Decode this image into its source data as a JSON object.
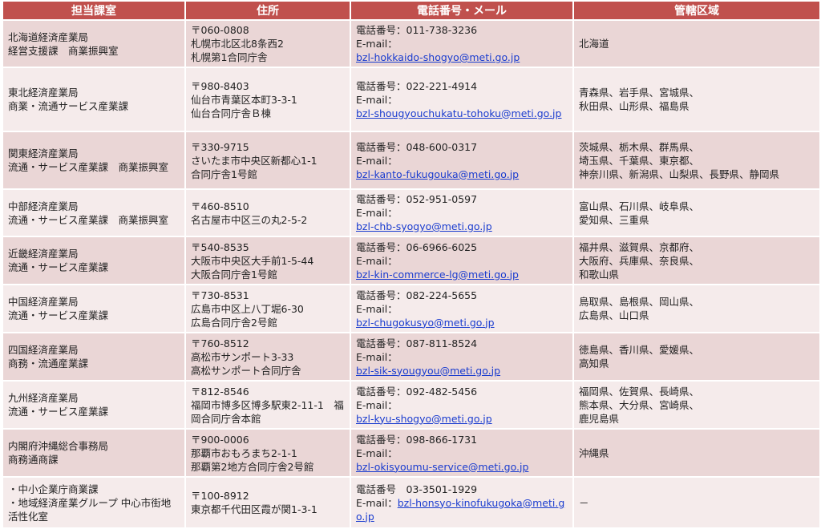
{
  "headers": [
    "担当課室",
    "住所",
    "電話番号・メール",
    "管轄区域"
  ],
  "rows": [
    {
      "dept": [
        "北海道経済産業局",
        "経営支援課　商業振興室"
      ],
      "addr": [
        "〒060-0808",
        "札幌市北区北8条西2",
        "札幌第1合同庁舎"
      ],
      "tel": "電話番号：011-738-3236",
      "mail_label": "E-mail：",
      "mail": "bzl-hokkaido-shogyo@meti.go.jp",
      "area": [
        "北海道"
      ]
    },
    {
      "dept": [
        "東北経済産業局",
        "商業・流通サービス産業課"
      ],
      "addr": [
        "〒980-8403",
        "仙台市青葉区本町3-3-1",
        "仙台合同庁舎Ｂ棟"
      ],
      "tel": "電話番号：022-221-4914",
      "mail_label": "E-mail：",
      "mail": "bzl-shougyouchukatu-tohoku@meti.go.jp",
      "area": [
        "青森県、岩手県、宮城県、",
        "秋田県、山形県、福島県"
      ]
    },
    {
      "dept": [
        "関東経済産業局",
        "流通・サービス産業課　商業振興室"
      ],
      "addr": [
        "〒330-9715",
        "さいたま市中央区新都心1-1",
        "合同庁舎1号館"
      ],
      "tel": "電話番号：048-600-0317",
      "mail_label": "E-mail：",
      "mail": "bzl-kanto-fukugouka@meti.go.jp",
      "area": [
        "茨城県、栃木県、群馬県、",
        "埼玉県、千葉県、東京都、",
        "神奈川県、新潟県、山梨県、長野県、静岡県"
      ]
    },
    {
      "dept": [
        "中部経済産業局",
        "流通・サービス産業課　商業振興室"
      ],
      "addr": [
        "〒460-8510",
        "名古屋市中区三の丸2-5-2"
      ],
      "tel": "電話番号：052-951-0597",
      "mail_label": "E-mail：",
      "mail": "bzl-chb-syogyo@meti.go.jp",
      "area": [
        "富山県、石川県、岐阜県、",
        "愛知県、三重県"
      ]
    },
    {
      "dept": [
        "近畿経済産業局",
        "流通・サービス産業課"
      ],
      "addr": [
        "〒540-8535",
        "大阪市中央区大手前1-5-44",
        "大阪合同庁舎1号館"
      ],
      "tel": "電話番号：06-6966-6025",
      "mail_label": "E-mail：",
      "mail": "bzl-kin-commerce-lg@meti.go.jp",
      "area": [
        "福井県、滋賀県、京都府、",
        "大阪府、兵庫県、奈良県、",
        "和歌山県"
      ]
    },
    {
      "dept": [
        "中国経済産業局",
        "流通・サービス産業課"
      ],
      "addr": [
        "〒730-8531",
        "広島市中区上八丁堀6-30",
        "広島合同庁舎2号館"
      ],
      "tel": "電話番号：082-224-5655",
      "mail_label": "E-mail：",
      "mail": "bzl-chugokusyo@meti.go.jp",
      "area": [
        "鳥取県、島根県、岡山県、",
        "広島県、山口県"
      ]
    },
    {
      "dept": [
        "四国経済産業局",
        "商務・流通産業課"
      ],
      "addr": [
        "〒760-8512",
        "高松市サンポート3-33",
        "高松サンポート合同庁舎"
      ],
      "tel": "電話番号：087-811-8524",
      "mail_label": "E-mail：",
      "mail": "bzl-sik-syougyou@meti.go.jp",
      "area": [
        "徳島県、香川県、愛媛県、",
        "高知県"
      ]
    },
    {
      "dept": [
        "九州経済産業局",
        "流通・サービス産業課"
      ],
      "addr": [
        "〒812-8546",
        "福岡市博多区博多駅東2-11-1　福岡合同庁舎本館"
      ],
      "tel": "電話番号：092-482-5456",
      "mail_label": "E-mail：",
      "mail": "bzl-kyu-shogyo@meti.go.jp",
      "area": [
        "福岡県、佐賀県、長崎県、",
        "熊本県、大分県、宮崎県、",
        "鹿児島県"
      ]
    },
    {
      "dept": [
        "内閣府沖縄総合事務局",
        "商務通商課"
      ],
      "addr": [
        "〒900-0006",
        "那覇市おもろまち2-1-1",
        "那覇第2地方合同庁舎2号館"
      ],
      "tel": "電話番号：098-866-1731",
      "mail_label": "E-mail：",
      "mail": "bzl-okisyoumu-service@meti.go.jp",
      "area": [
        "沖縄県"
      ]
    },
    {
      "dept": [
        "・中小企業庁商業課",
        "・地域経済産業グループ 中心市街地活性化室"
      ],
      "addr": [
        "〒100-8912",
        "東京都千代田区霞が関1-3-1"
      ],
      "tel": "電話番号　03-3501-1929",
      "mail_label": "E-mail：",
      "mail": "bzl-honsyo-kinofukugoka@meti.go.jp",
      "area": [
        "－"
      ]
    }
  ]
}
